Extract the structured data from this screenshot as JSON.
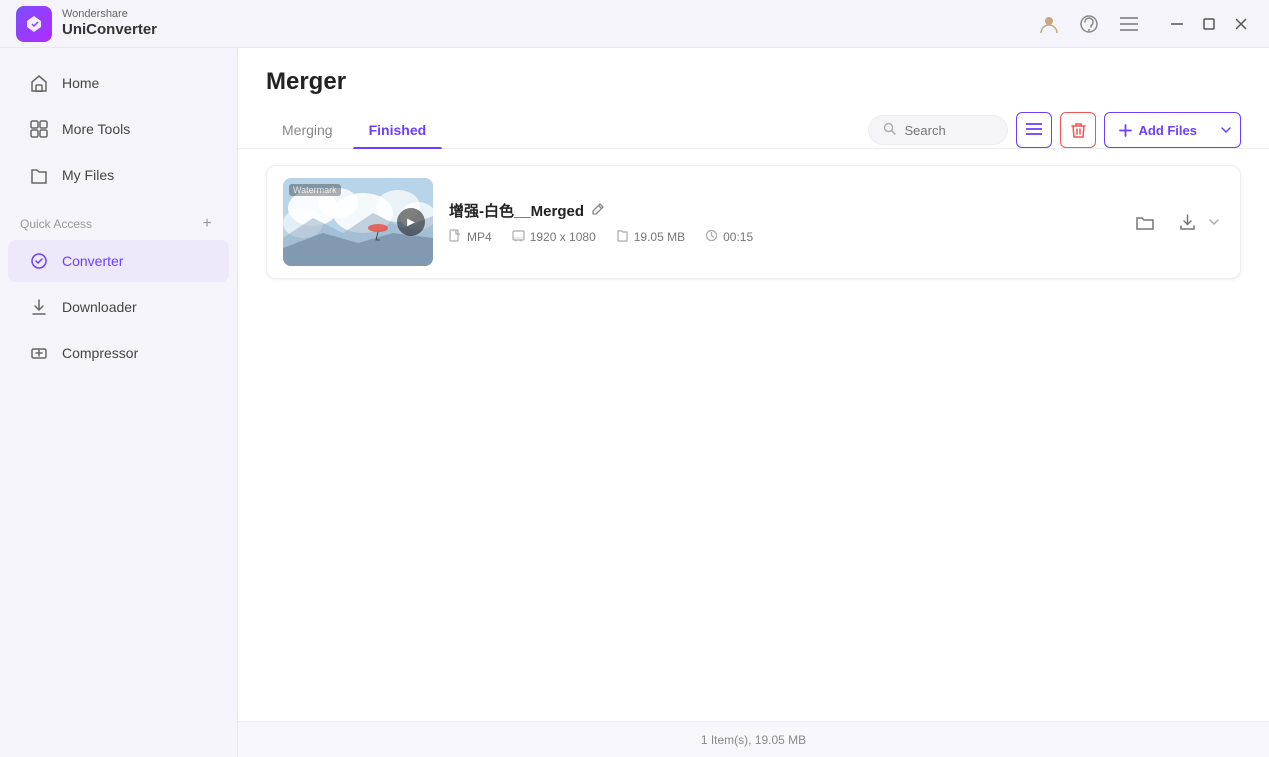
{
  "app": {
    "brand": "Wondershare",
    "name": "UniConverter",
    "logo_text": "▶"
  },
  "titlebar": {
    "profile_icon": "👤",
    "support_icon": "🎧",
    "menu_icon": "☰",
    "minimize_icon": "─",
    "maximize_icon": "□",
    "close_icon": "✕"
  },
  "sidebar": {
    "items": [
      {
        "id": "home",
        "label": "Home",
        "icon": "🏠"
      },
      {
        "id": "more-tools",
        "label": "More Tools",
        "icon": "⊞"
      },
      {
        "id": "my-files",
        "label": "My Files",
        "icon": "📁"
      }
    ],
    "quick_access_label": "Quick Access",
    "quick_access_add_icon": "+",
    "quick_access_items": [
      {
        "id": "converter",
        "label": "Converter",
        "icon": "🔄"
      },
      {
        "id": "downloader",
        "label": "Downloader",
        "icon": "⬇"
      },
      {
        "id": "compressor",
        "label": "Compressor",
        "icon": "🗜"
      }
    ]
  },
  "page": {
    "title": "Merger",
    "tabs": [
      {
        "id": "merging",
        "label": "Merging"
      },
      {
        "id": "finished",
        "label": "Finished"
      }
    ],
    "active_tab": "finished"
  },
  "toolbar": {
    "search_placeholder": "Search",
    "list_view_icon": "☰",
    "delete_icon": "🗑",
    "add_files_label": "+ Add Files",
    "add_files_arrow": "▼"
  },
  "files": [
    {
      "name": "增强-白色__Merged",
      "format": "MP4",
      "resolution": "1920 x 1080",
      "size": "19.05 MB",
      "duration": "00:15"
    }
  ],
  "status": {
    "text": "1 Item(s), 19.05 MB"
  }
}
